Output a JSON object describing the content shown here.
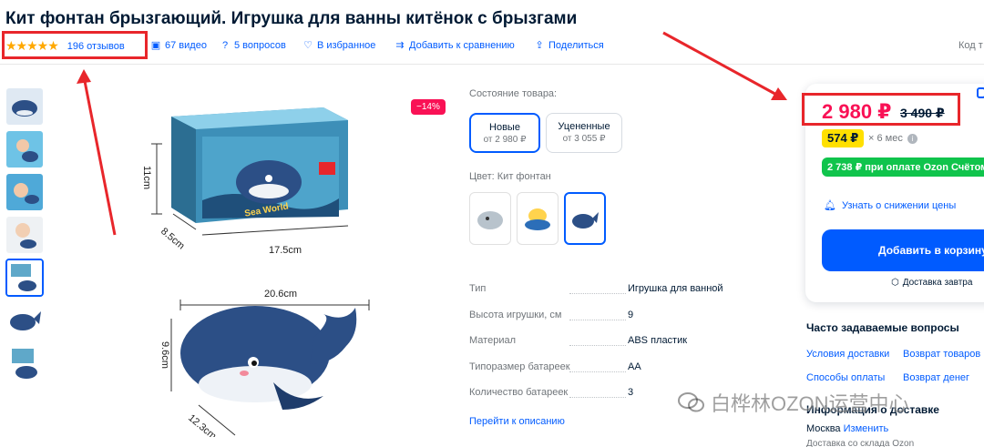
{
  "product": {
    "title": "Кит фонтан брызгающий. Игрушка для ванны китёнок с брызгами"
  },
  "meta_bar": {
    "stars": "★★★★★",
    "reviews": "196 отзывов",
    "videos": "67 видео",
    "questions": "5 вопросов",
    "favorites": "В избранное",
    "compare": "Добавить к сравнению",
    "share": "Поделиться",
    "code_label": "Код т"
  },
  "discount_badge": "−14%",
  "image_dimensions": {
    "box_height": "11cm",
    "box_depth": "8.5cm",
    "box_width": "17.5cm",
    "whale_length": "20.6cm",
    "whale_height": "9.6cm",
    "whale_depth": "12.3cm",
    "box_brand": "Sea World"
  },
  "condition": {
    "label": "Состояние товара:",
    "options": [
      {
        "title": "Новые",
        "price": "от 2 980 ₽"
      },
      {
        "title": "Уцененные",
        "price": "от 3 055 ₽"
      }
    ]
  },
  "color": {
    "label": "Цвет: Кит фонтан"
  },
  "specs": [
    {
      "key": "Тип",
      "value": "Игрушка для ванной"
    },
    {
      "key": "Высота игрушки, см",
      "value": "9"
    },
    {
      "key": "Материал",
      "value": "ABS пластик"
    },
    {
      "key": "Типоразмер батареек",
      "value": "AA"
    },
    {
      "key": "Количество батареек",
      "value": "3"
    }
  ],
  "specs_link": "Перейти к описанию",
  "buybox": {
    "price": "2 980 ₽",
    "old_price": "3 490 ₽",
    "installment": "574 ₽",
    "installment_term": "× 6 мес",
    "ozon_card": "2 738 ₽ при оплате Ozon Счётом",
    "notify": "Узнать о снижении цены",
    "add_to_cart": "Добавить в корзину",
    "delivery": "Доставка завтра"
  },
  "faq": {
    "title": "Часто задаваемые вопросы",
    "links": [
      "Условия доставки",
      "Возврат товаров",
      "Способы оплаты",
      "Возврат денег"
    ]
  },
  "info": {
    "title": "Информация о доставке",
    "city": "Москва",
    "change": "Изменить",
    "warehouse": "Доставка со склада Ozon"
  },
  "watermark": "白桦林OZON运营中心",
  "colors": {
    "accent": "#005bff",
    "price": "#f91155",
    "stars": "#ffa800",
    "highlight": "#e8262b",
    "green": "#10c44c",
    "installment": "#ffe000"
  }
}
